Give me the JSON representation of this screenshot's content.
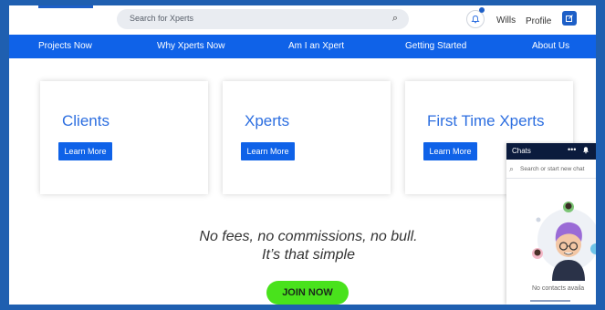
{
  "header": {
    "search_placeholder": "Search for Xperts",
    "user_name": "Wills",
    "profile_label": "Profile"
  },
  "nav": {
    "items": [
      "Projects Now",
      "Why Xperts Now",
      "Am I an Xpert",
      "Getting Started",
      "About Us"
    ]
  },
  "cards": [
    {
      "title": "Clients",
      "button": "Learn More"
    },
    {
      "title": "Xperts",
      "button": "Learn More"
    },
    {
      "title": "First Time Xperts",
      "button": "Learn More"
    }
  ],
  "tagline": {
    "line1": "No fees, no commissions, no bull.",
    "line2": "It’s that simple"
  },
  "join_button": "JOIN NOW",
  "chat": {
    "title": "Chats",
    "menu_icon": "•••",
    "search_placeholder": "Search or start new chat",
    "empty_text": "No contacts availa"
  },
  "colors": {
    "brand_blue": "#0f62e8",
    "join_green": "#49e21c",
    "chat_header": "#0b1b3d",
    "frame_blue": "#1f5fb0"
  },
  "icons": {
    "search": "magnifier-icon",
    "bell": "bell-icon",
    "edit": "edit-icon",
    "chat_bell": "bell-icon"
  }
}
